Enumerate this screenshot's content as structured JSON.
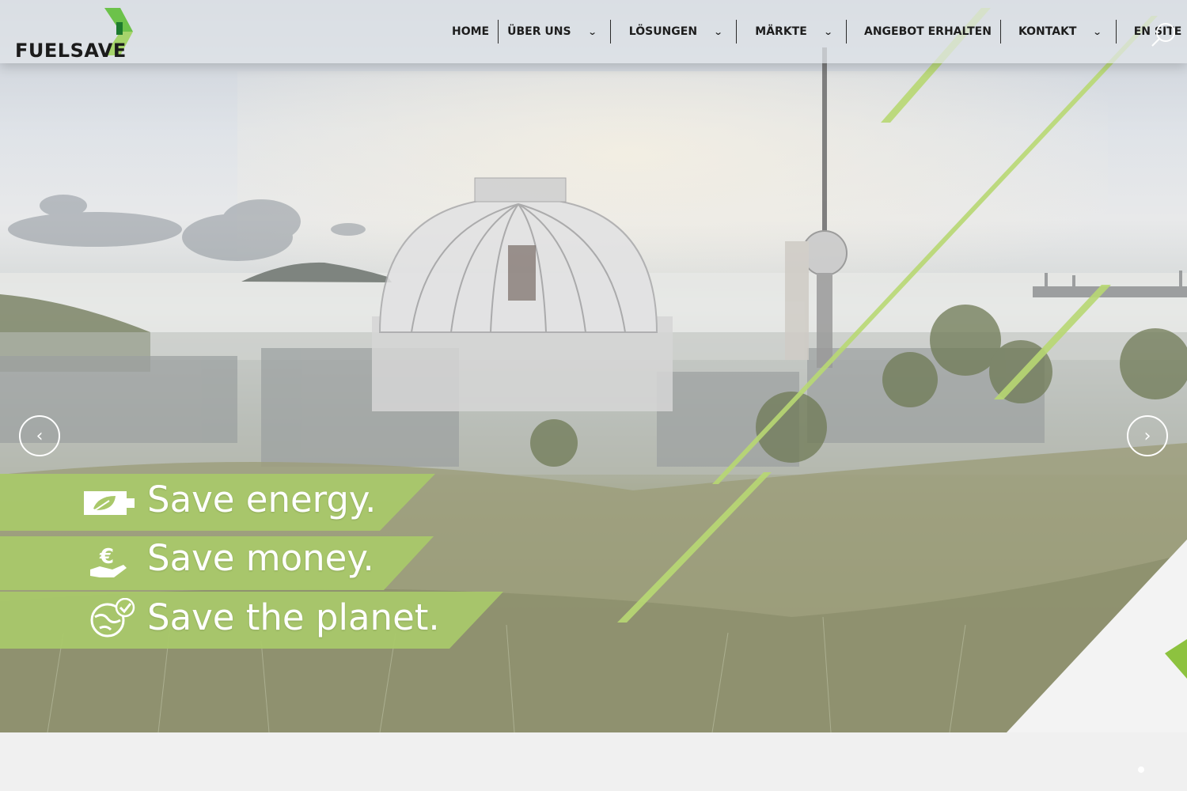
{
  "brand": {
    "name": "FUELSAVE",
    "colors": {
      "green": "#a9c86a",
      "bright_green": "#5bb832",
      "dark": "#1b1b1b"
    }
  },
  "nav": {
    "items": [
      {
        "label": "HOME",
        "dropdown": false
      },
      {
        "label": "ÜBER UNS",
        "dropdown": true
      },
      {
        "label": "LÖSUNGEN",
        "dropdown": true
      },
      {
        "label": "MÄRKTE",
        "dropdown": true
      },
      {
        "label": "ANGEBOT ERHALTEN",
        "dropdown": false
      },
      {
        "label": "KONTAKT",
        "dropdown": true
      },
      {
        "label": "EN SITE",
        "dropdown": false
      }
    ],
    "chevron": "⌄",
    "search_icon": "search-icon"
  },
  "slider": {
    "prev": "‹",
    "next": "›",
    "slogans": [
      {
        "text": "Save energy.",
        "icon": "energy-plug-icon"
      },
      {
        "text": "Save money.",
        "icon": "euro-hand-icon"
      },
      {
        "text": "Save the planet.",
        "icon": "globe-check-icon"
      }
    ]
  }
}
